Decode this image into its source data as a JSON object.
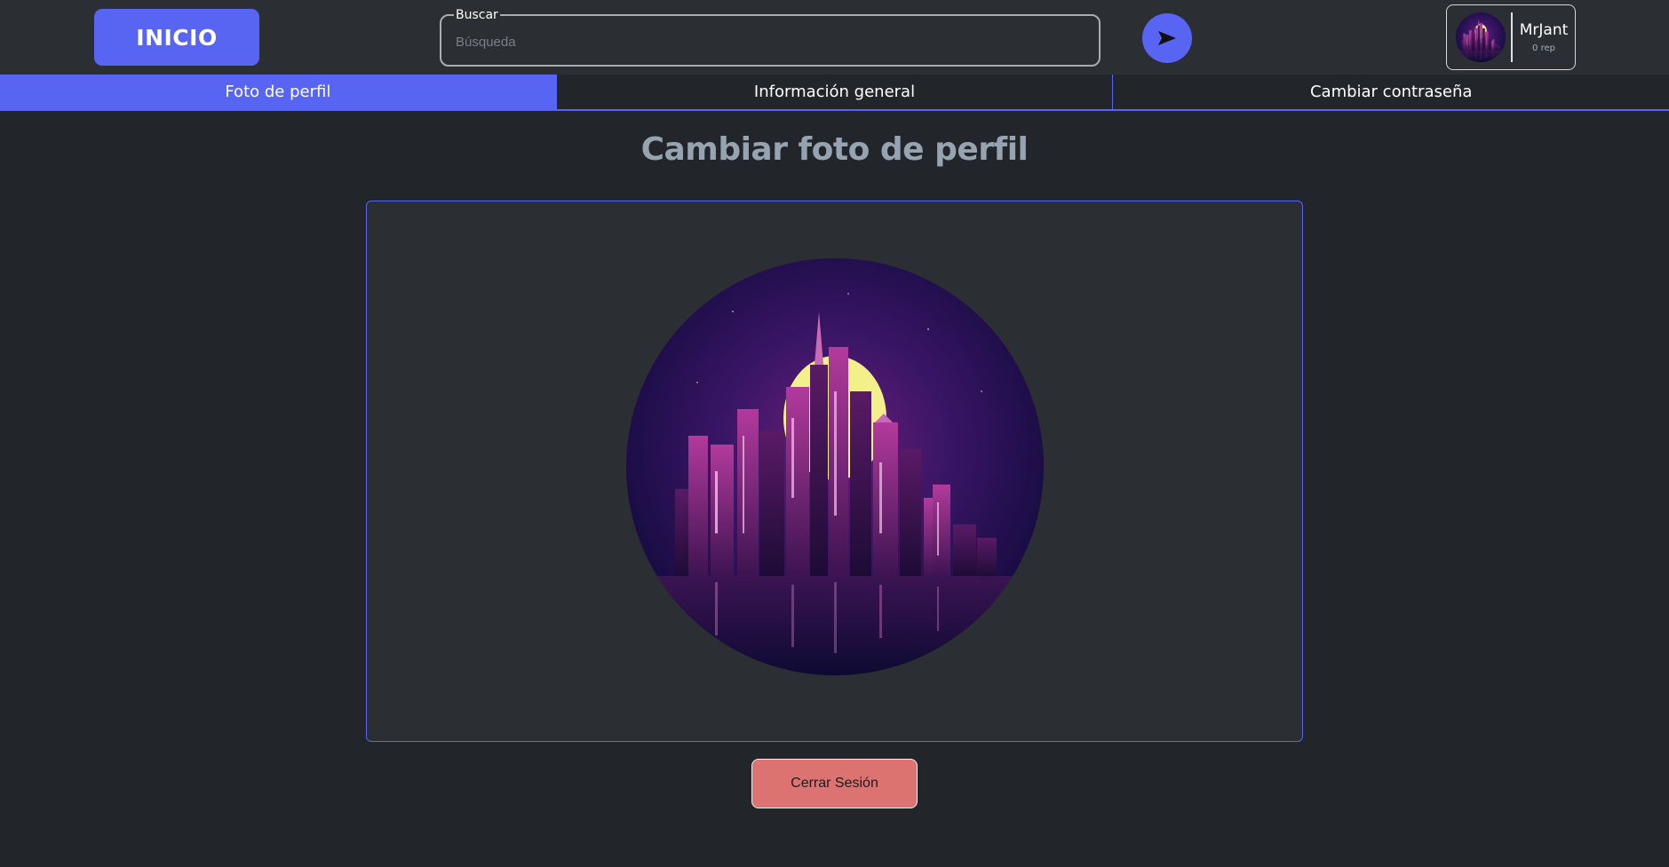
{
  "header": {
    "home_label": "INICIO",
    "search": {
      "legend": "Buscar",
      "placeholder": "Búsqueda",
      "value": ""
    },
    "send_icon": "send-arrow-icon",
    "user": {
      "name": "MrJant",
      "rep": "0 rep",
      "avatar": "city-skyline-avatar"
    }
  },
  "tabs": [
    {
      "label": "Foto de perfil",
      "active": true
    },
    {
      "label": "Información general",
      "active": false
    },
    {
      "label": "Cambiar contraseña",
      "active": false
    }
  ],
  "main": {
    "title": "Cambiar foto de perfil",
    "photo": "city-skyline-profile-photo",
    "logout_label": "Cerrar Sesión"
  },
  "colors": {
    "accent": "#5865f2",
    "background": "#222529",
    "surface": "#2b2e33",
    "title": "#96a3b0",
    "danger": "#dc7370"
  }
}
